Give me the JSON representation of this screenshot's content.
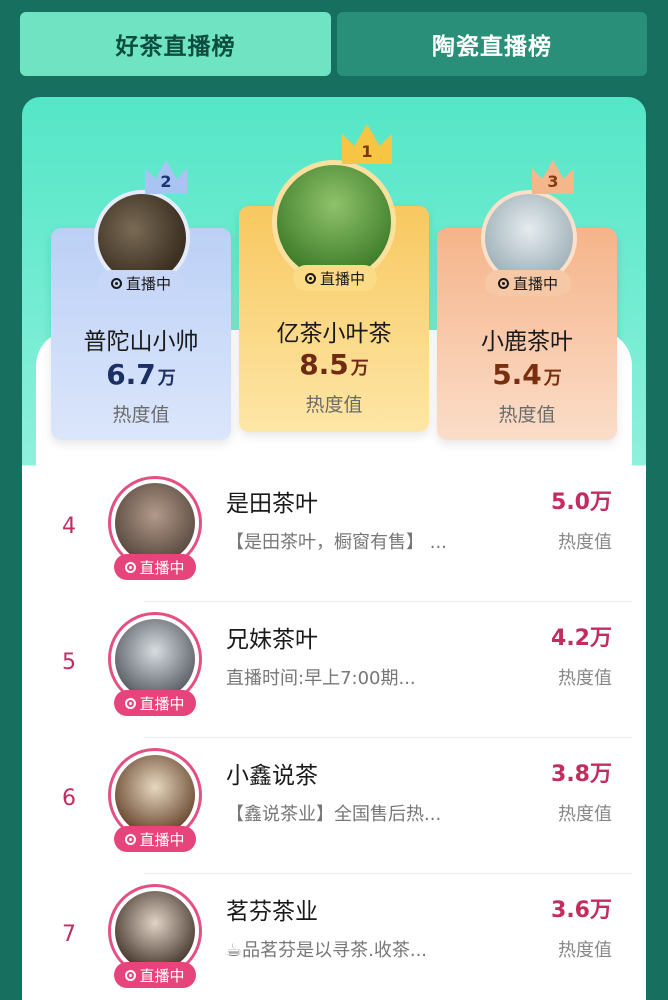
{
  "tabs": {
    "left": "好茶直播榜",
    "right": "陶瓷直播榜"
  },
  "live_label": "直播中",
  "heat_label": "热度值",
  "top3": [
    {
      "rank": "1",
      "name": "亿茶小叶茶",
      "heat": "8.5",
      "unit": "万"
    },
    {
      "rank": "2",
      "name": "普陀山小帅",
      "heat": "6.7",
      "unit": "万"
    },
    {
      "rank": "3",
      "name": "小鹿茶叶",
      "heat": "5.4",
      "unit": "万"
    }
  ],
  "list": [
    {
      "rank": "4",
      "name": "是田茶叶",
      "desc": "【是田茶叶，橱窗有售】 ...",
      "heat": "5.0万"
    },
    {
      "rank": "5",
      "name": "兄妹茶叶",
      "desc": "直播时间:早上7:00期...",
      "heat": "4.2万"
    },
    {
      "rank": "6",
      "name": "小鑫说茶",
      "desc": "【鑫说茶业】全国售后热...",
      "heat": "3.8万"
    },
    {
      "rank": "7",
      "name": "茗芬茶业",
      "desc": "☕品茗芬是以寻茶.收茶...",
      "heat": "3.6万"
    }
  ],
  "colors": {
    "background": "#17705f",
    "tab_active": "#6fe3c2",
    "accent_pink": "#c22d5e",
    "gold": "#f8c444",
    "silver_blue": "#aac4f2",
    "bronze": "#f4b78c"
  },
  "icons": {
    "live": "live-dot-icon",
    "crown": "crown-icon"
  }
}
